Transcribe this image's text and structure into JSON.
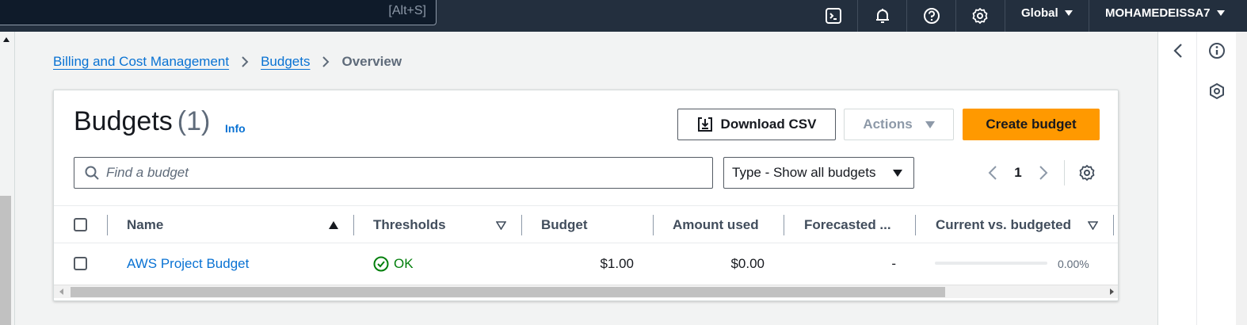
{
  "topnav": {
    "search_shortcut": "[Alt+S]",
    "region": "Global",
    "account": "MOHAMEDEISSA7",
    "icons": [
      "cloudshell-icon",
      "bell-icon",
      "help-icon",
      "gear-icon"
    ]
  },
  "breadcrumb": {
    "items": [
      "Billing and Cost Management",
      "Budgets"
    ],
    "current": "Overview"
  },
  "header": {
    "title": "Budgets",
    "count": "(1)",
    "info": "Info"
  },
  "buttons": {
    "download": "Download CSV",
    "actions": "Actions",
    "create": "Create budget"
  },
  "filter": {
    "search_placeholder": "Find a budget",
    "type_select": "Type - Show all budgets"
  },
  "pagination": {
    "current_page": "1"
  },
  "table": {
    "columns": [
      "Name",
      "Thresholds",
      "Budget",
      "Amount used",
      "Forecasted ...",
      "Current vs. budgeted"
    ],
    "rows": [
      {
        "name": "AWS Project Budget",
        "thresholds": "OK",
        "budget": "$1.00",
        "amount_used": "$0.00",
        "forecasted": "-",
        "current_vs_budgeted": "0.00%",
        "progress_fraction": 0.0
      }
    ]
  },
  "colors": {
    "nav_bg": "#232f3e",
    "link": "#0972d3",
    "primary_button": "#ff9900",
    "ok": "#037f0c"
  }
}
